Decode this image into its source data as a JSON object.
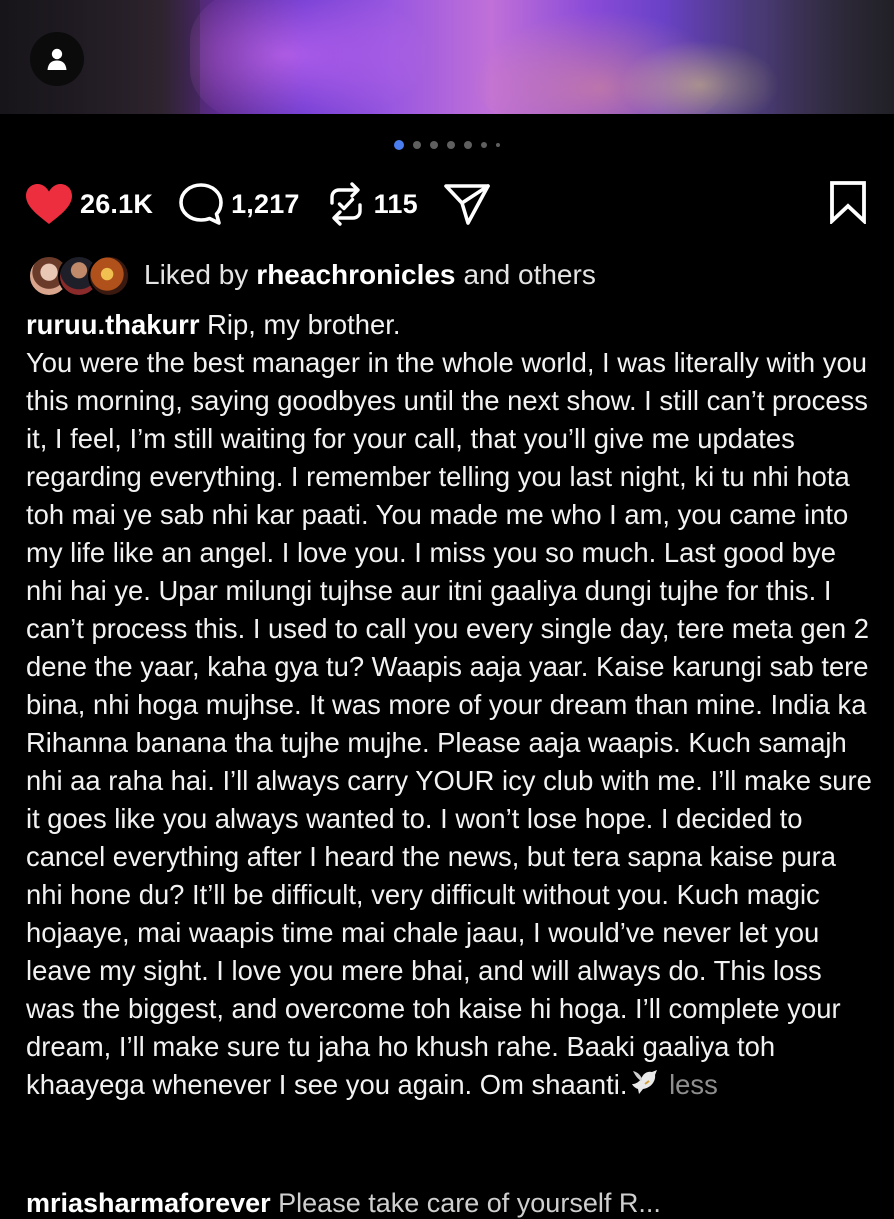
{
  "media": {
    "carousel_dots": 7,
    "active_index": 0
  },
  "actions": {
    "likes": "26.1K",
    "comments": "1,217",
    "reposts": "115",
    "like_color": "#ed2e3e"
  },
  "liked_by": {
    "prefix": "Liked by",
    "user": "rheachronicles",
    "suffix": "and others"
  },
  "caption": {
    "username": "ruruu.thakurr",
    "text": "Rip, my brother.\nYou were the best manager in the whole world, I was literally with you this morning, saying goodbyes until the next show. I still can’t process it, I feel, I’m still waiting for your call, that you’ll give me updates regarding everything. I remember telling you last night, ki tu nhi hota toh mai ye sab nhi kar paati. You made me who I am, you came into my life like an angel. I love you. I miss you so much. Last good bye nhi hai ye. Upar milungi tujhse aur itni gaaliya dungi tujhe for this. I can’t process this. I used to call you every single day, tere meta gen 2 dene the yaar, kaha gya tu? Waapis aaja yaar. Kaise karungi sab tere bina, nhi hoga mujhse. It was more of your dream than mine. India ka Rihanna banana tha tujhe mujhe. Please aaja waapis. Kuch samajh nhi aa raha hai. I’ll always carry YOUR icy club with me. I’ll make sure it goes like you always wanted to. I won’t lose hope. I decided to cancel everything after I heard the news, but tera sapna kaise pura nhi hone du? It’ll be difficult, very difficult without you. Kuch magic hojaaye, mai waapis time mai chale jaau, I would’ve never let you leave my sight. I love you mere bhai, and will always do. This loss was the biggest, and overcome toh kaise hi hoga. I’ll complete your dream, I’ll make sure tu jaha ho khush rahe. Baaki gaaliya toh khaayega whenever I see you again. Om shaanti.",
    "less_label": "less"
  },
  "next_comment": {
    "username": "mriasharmaforever",
    "text": "Please take care of yourself R..."
  }
}
